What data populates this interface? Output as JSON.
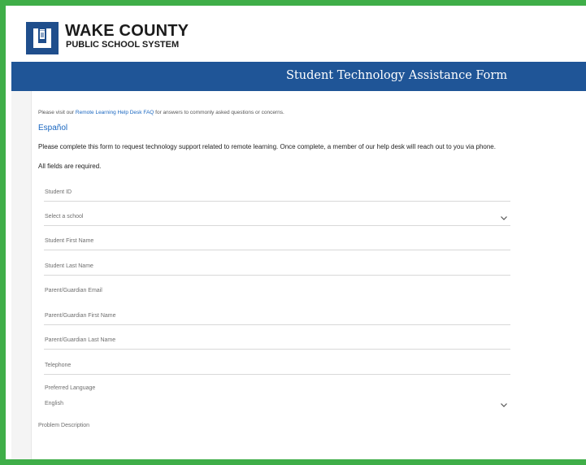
{
  "brand": {
    "name": "WAKE COUNTY",
    "subtitle": "PUBLIC SCHOOL SYSTEM",
    "color": "#1f4e8c"
  },
  "header": {
    "title": "Student Technology Assistance Form",
    "color": "#1f5597"
  },
  "intro": {
    "faq_prefix": "Please visit our ",
    "faq_link": "Remote Learning Help Desk FAQ",
    "faq_suffix": " for answers to commonly asked questions or concerns.",
    "espanol_link": "Español",
    "instructions": "Please complete this form to request technology support related to remote learning. Once complete, a member of our help desk will reach out to you via phone.",
    "required_note": "All fields are required."
  },
  "form": {
    "student_id": "Student ID",
    "school_select": "Select a school",
    "student_first_name": "Student First Name",
    "student_last_name": "Student Last Name",
    "guardian_email": "Parent/Guardian Email",
    "guardian_first_name": "Parent/Guardian First Name",
    "guardian_last_name": "Parent/Guardian Last Name",
    "telephone": "Telephone",
    "preferred_language_label": "Preferred Language",
    "preferred_language_value": "English",
    "problem_description": "Problem Description"
  },
  "colors": {
    "frame_border": "#3fae48",
    "link": "#1a67c0"
  },
  "icons": {
    "logo": "wcpss-logo-icon",
    "dropdown": "chevron-down-icon"
  }
}
